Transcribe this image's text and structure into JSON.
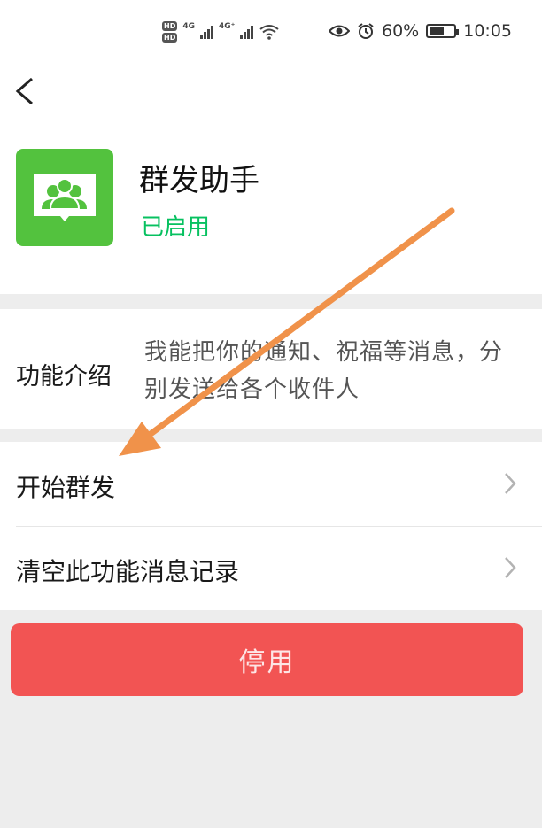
{
  "status_bar": {
    "hd_badges": [
      "HD",
      "HD"
    ],
    "network_types": [
      "4G",
      "4G⁺"
    ],
    "battery_percent": "60%",
    "battery_level": 0.6,
    "time": "10:05",
    "icons": [
      "eye-icon",
      "alarm-icon",
      "wifi-icon",
      "signal-icon",
      "battery-icon"
    ]
  },
  "header": {
    "back_icon": "chevron-left-icon",
    "app_name": "群发助手",
    "app_status": "已启用",
    "app_icon": "group-chat-icon"
  },
  "intro": {
    "label": "功能介绍",
    "text": "我能把你的通知、祝福等消息，分别发送给各个收件人"
  },
  "menu": {
    "items": [
      {
        "label": "开始群发"
      },
      {
        "label": "清空此功能消息记录"
      }
    ]
  },
  "actions": {
    "disable_label": "停用"
  },
  "colors": {
    "accent_green": "#07c160",
    "icon_green": "#53c23e",
    "danger_red": "#f25453",
    "annotation_arrow": "#f0924a"
  }
}
